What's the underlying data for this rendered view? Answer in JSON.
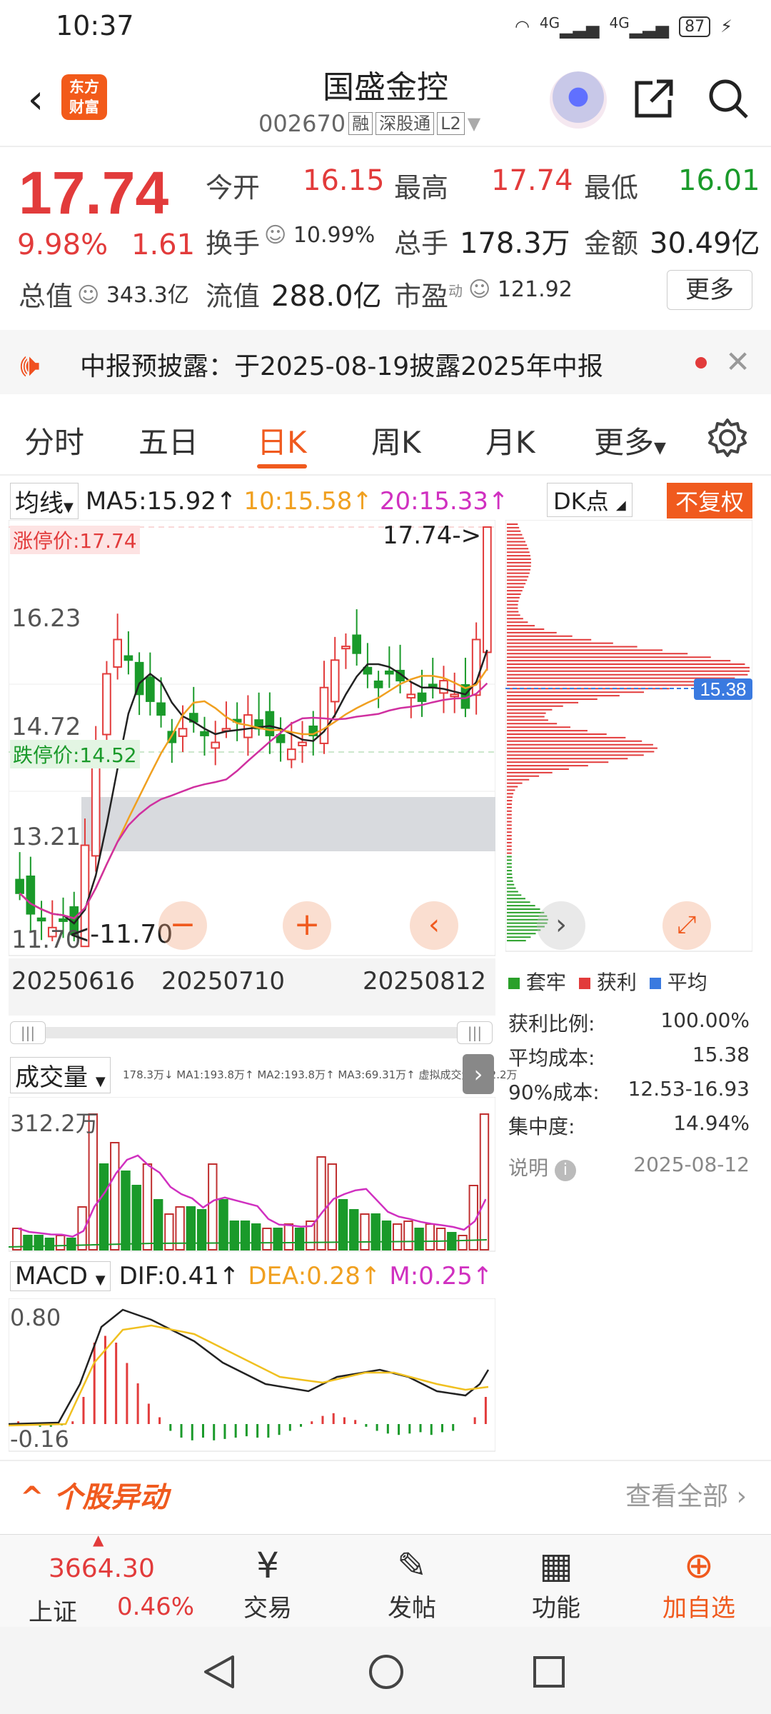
{
  "status": {
    "time": "10:37",
    "signal1": "4G",
    "signal2": "4G",
    "battery": "87"
  },
  "header": {
    "logo_line1": "东方",
    "logo_line2": "财富",
    "name": "国盛金控",
    "code": "002670",
    "tag1": "融",
    "tag2": "深股通",
    "tag3": "L2"
  },
  "quote": {
    "price": "17.74",
    "pct": "9.98%",
    "chg": "1.61",
    "open_label": "今开",
    "open": "16.15",
    "high_label": "最高",
    "high": "17.74",
    "low_label": "最低",
    "low": "16.01",
    "turnover_label": "换手",
    "turnover": "10.99%",
    "volume_label": "总手",
    "volume": "178.3万",
    "amount_label": "金额",
    "amount": "30.49亿",
    "mktcap_label": "总值",
    "mktcap": "343.3亿",
    "float_label": "流值",
    "float": "288.0亿",
    "pe_label": "市盈",
    "pe_sup": "动",
    "pe": "121.92",
    "more": "更多"
  },
  "notice": {
    "text": "中报预披露：于2025-08-19披露2025年中报"
  },
  "tabs": [
    "分时",
    "五日",
    "日K",
    "周K",
    "月K",
    "更多"
  ],
  "indicators": {
    "ma_label": "均线",
    "ma5": "MA5:15.92",
    "ma10": "10:15.58",
    "ma20": "20:15.33",
    "dk": "DK点",
    "fuquan": "不复权"
  },
  "kchart_labels": {
    "limit_up": "涨停价:17.74",
    "limit_down": "跌停价:14.52",
    "y_top": "16.23",
    "y_mid": "14.72",
    "y_low": "13.21",
    "y_min": "11.70",
    "last_mark": "17.74->",
    "low_mark": "<-11.70",
    "dates": [
      "20250616",
      "20250710",
      "20250812"
    ]
  },
  "chart_data": {
    "type": "candlestick",
    "closes_approx": [
      12.4,
      12.1,
      12.0,
      11.9,
      12.0,
      11.8,
      13.1,
      14.5,
      15.6,
      16.1,
      15.8,
      15.3,
      15.2,
      15.0,
      14.6,
      14.8,
      14.9,
      14.7,
      14.6,
      14.8,
      14.9,
      15.0,
      14.8,
      14.7,
      14.6,
      14.5,
      14.6,
      14.7,
      15.4,
      15.8,
      16.0,
      15.9,
      15.6,
      15.4,
      15.6,
      15.5,
      15.3,
      15.2,
      15.4,
      15.5,
      15.3,
      15.1,
      16.1,
      17.74
    ],
    "ma5": 15.92,
    "ma10": 15.58,
    "ma20": 15.33,
    "ylim": [
      11.7,
      17.74
    ]
  },
  "profile": {
    "avg_price": "15.38",
    "legend": [
      "套牢",
      "获利",
      "平均"
    ]
  },
  "chips": {
    "profit_ratio_label": "获利比例:",
    "profit_ratio": "100.00%",
    "avg_cost_label": "平均成本:",
    "avg_cost": "15.38",
    "cost90_label": "90%成本:",
    "cost90": "12.53-16.93",
    "concentration_label": "集中度:",
    "concentration": "14.94%",
    "note_label": "说明",
    "note_date": "2025-08-12"
  },
  "volume": {
    "label": "成交量",
    "legend": "178.3万↓ MA1:193.8万↑ MA2:193.8万↑ MA3:69.31万↑ 虚拟成交量:312.2万",
    "ymax": "312.2万"
  },
  "macd": {
    "label": "MACD",
    "dif": "DIF:0.41",
    "dea": "DEA:0.28",
    "m": "M:0.25",
    "ymax": "0.80",
    "ymin": "-0.16"
  },
  "section": {
    "title": "个股异动",
    "view_all": "查看全部"
  },
  "bottom": {
    "index_value": "3664.30",
    "index_name": "上证",
    "index_pct": "0.46%",
    "trade": "交易",
    "post": "发帖",
    "function": "功能",
    "watch": "加自选"
  }
}
